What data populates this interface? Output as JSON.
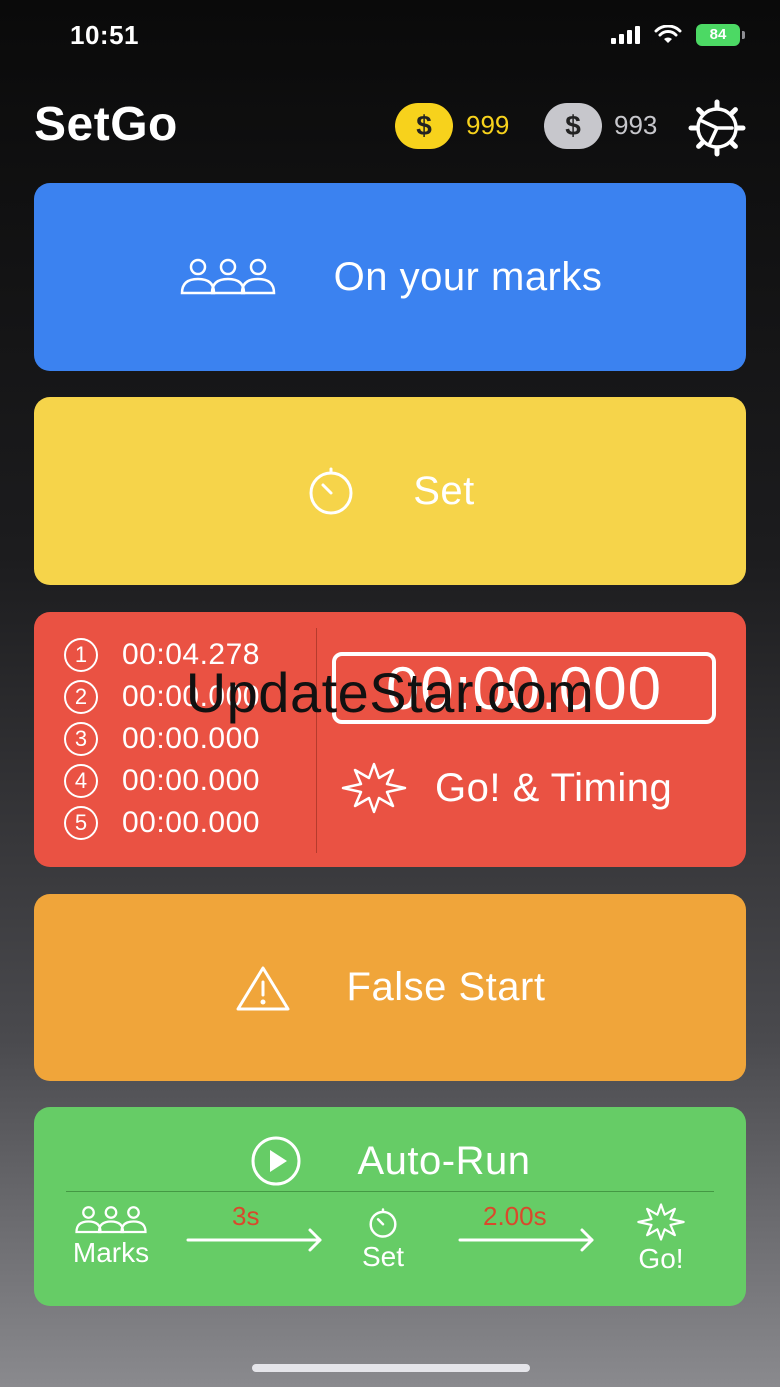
{
  "status_bar": {
    "time": "10:51",
    "battery": "84"
  },
  "header": {
    "title": "SetGo",
    "gold_symbol": "$",
    "gold_count": "999",
    "silver_symbol": "$",
    "silver_count": "993"
  },
  "marks_card": {
    "label": "On your marks",
    "icon": "people-icon"
  },
  "set_card": {
    "label": "Set",
    "icon": "stopwatch-icon"
  },
  "timing_card": {
    "laps": [
      {
        "num": "1",
        "time": "00:04.278"
      },
      {
        "num": "2",
        "time": "00:00.000"
      },
      {
        "num": "3",
        "time": "00:00.000"
      },
      {
        "num": "4",
        "time": "00:00.000"
      },
      {
        "num": "5",
        "time": "00:00.000"
      }
    ],
    "timer": "00:00.000",
    "label": "Go! & Timing",
    "icon": "starburst-icon"
  },
  "watermark": "UpdateStar.com",
  "false_start_card": {
    "label": "False Start",
    "icon": "warning-icon"
  },
  "autorun_card": {
    "label": "Auto-Run",
    "icon": "play-icon",
    "steps": {
      "marks": "Marks",
      "set": "Set",
      "go": "Go!"
    },
    "delay_marks_to_set": "3s",
    "delay_set_to_go": "2.00s"
  },
  "colors": {
    "blue": "#3b82f0",
    "yellow": "#f6d44a",
    "red": "#ea5243",
    "orange": "#f0a53a",
    "green": "#66cc66",
    "gold": "#f7d21c",
    "silver": "#c7c7cc",
    "delay_text": "#d9492c"
  }
}
